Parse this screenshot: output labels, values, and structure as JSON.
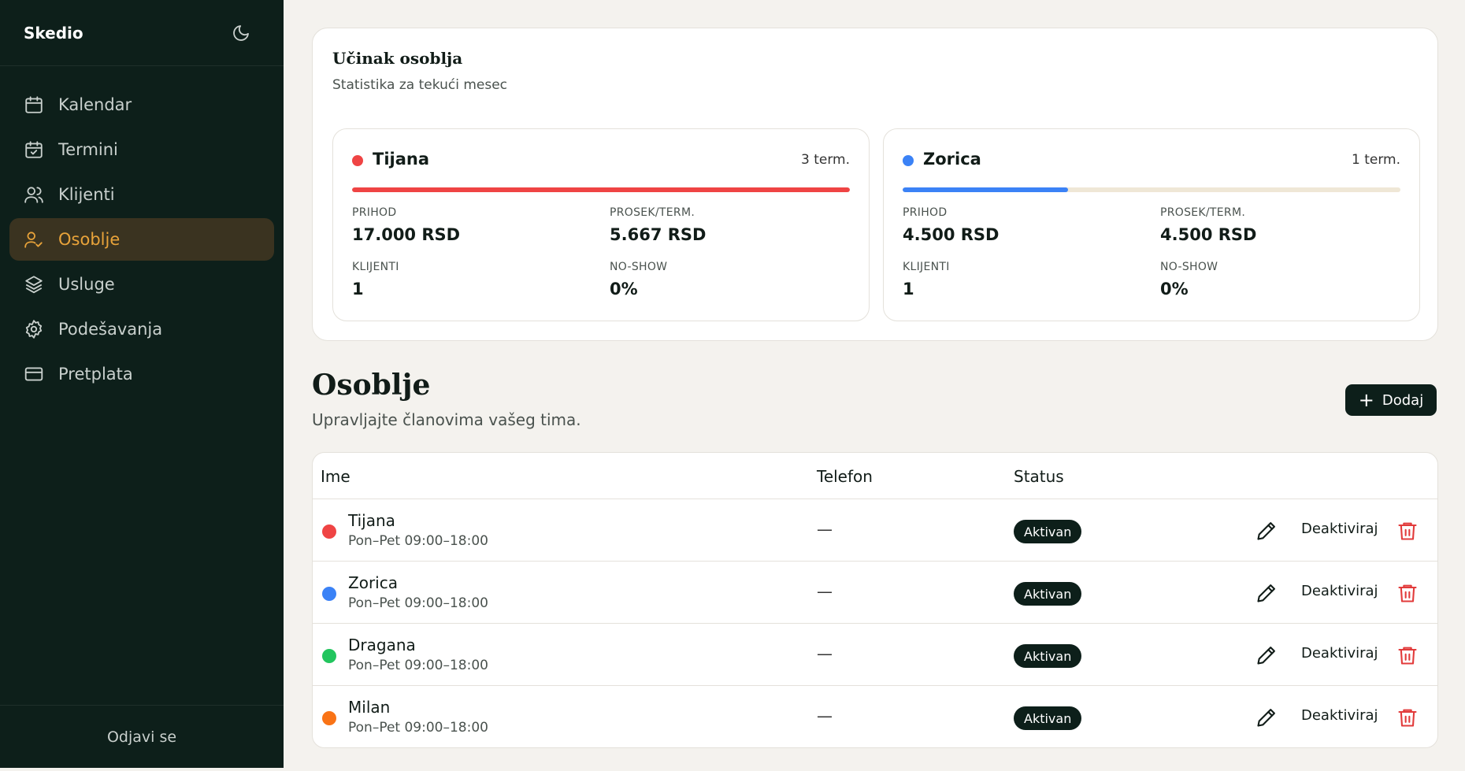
{
  "app": {
    "brand": "Skedio",
    "accent": "#e8a33a",
    "sidebar_bg": "#0d1f1a"
  },
  "sidebar": {
    "items": [
      {
        "label": "Kalendar",
        "icon": "calendar-icon"
      },
      {
        "label": "Termini",
        "icon": "calendar-check-icon"
      },
      {
        "label": "Klijenti",
        "icon": "users-icon"
      },
      {
        "label": "Osoblje",
        "icon": "user-check-icon",
        "active": true
      },
      {
        "label": "Usluge",
        "icon": "layers-icon"
      },
      {
        "label": "Podešavanja",
        "icon": "gear-icon"
      },
      {
        "label": "Pretplata",
        "icon": "credit-card-icon"
      }
    ],
    "logout": "Odjavi se"
  },
  "stats": {
    "title": "Učinak osoblja",
    "subtitle": "Statistika za tekući mesec",
    "cards": [
      {
        "name": "Tijana",
        "color": "#ef4444",
        "count": "3 term.",
        "progress": 1.0,
        "prihod_label": "PRIHOD",
        "prihod": "17.000 RSD",
        "prosek_label": "PROSEK/TERM.",
        "prosek": "5.667 RSD",
        "klijenti_label": "KLIJENTI",
        "klijenti": "1",
        "noshow_label": "NO-SHOW",
        "noshow": "0%"
      },
      {
        "name": "Zorica",
        "color": "#3b82f6",
        "count": "1 term.",
        "progress": 0.333,
        "prihod_label": "PRIHOD",
        "prihod": "4.500 RSD",
        "prosek_label": "PROSEK/TERM.",
        "prosek": "4.500 RSD",
        "klijenti_label": "KLIJENTI",
        "klijenti": "1",
        "noshow_label": "NO-SHOW",
        "noshow": "0%"
      }
    ]
  },
  "page": {
    "title": "Osoblje",
    "subtitle": "Upravljajte članovima vašeg tima.",
    "add_label": "Dodaj"
  },
  "table": {
    "columns": [
      "Ime",
      "Telefon",
      "Status"
    ],
    "rows": [
      {
        "name": "Tijana",
        "hours": "Pon–Pet 09:00–18:00",
        "phone": "—",
        "status": "Aktivan",
        "action": "Deaktiviraj",
        "color": "#ef4444"
      },
      {
        "name": "Zorica",
        "hours": "Pon–Pet 09:00–18:00",
        "phone": "—",
        "status": "Aktivan",
        "action": "Deaktiviraj",
        "color": "#3b82f6"
      },
      {
        "name": "Dragana",
        "hours": "Pon–Pet 09:00–18:00",
        "phone": "—",
        "status": "Aktivan",
        "action": "Deaktiviraj",
        "color": "#22c55e"
      },
      {
        "name": "Milan",
        "hours": "Pon–Pet 09:00–18:00",
        "phone": "—",
        "status": "Aktivan",
        "action": "Deaktiviraj",
        "color": "#f97316"
      }
    ]
  }
}
